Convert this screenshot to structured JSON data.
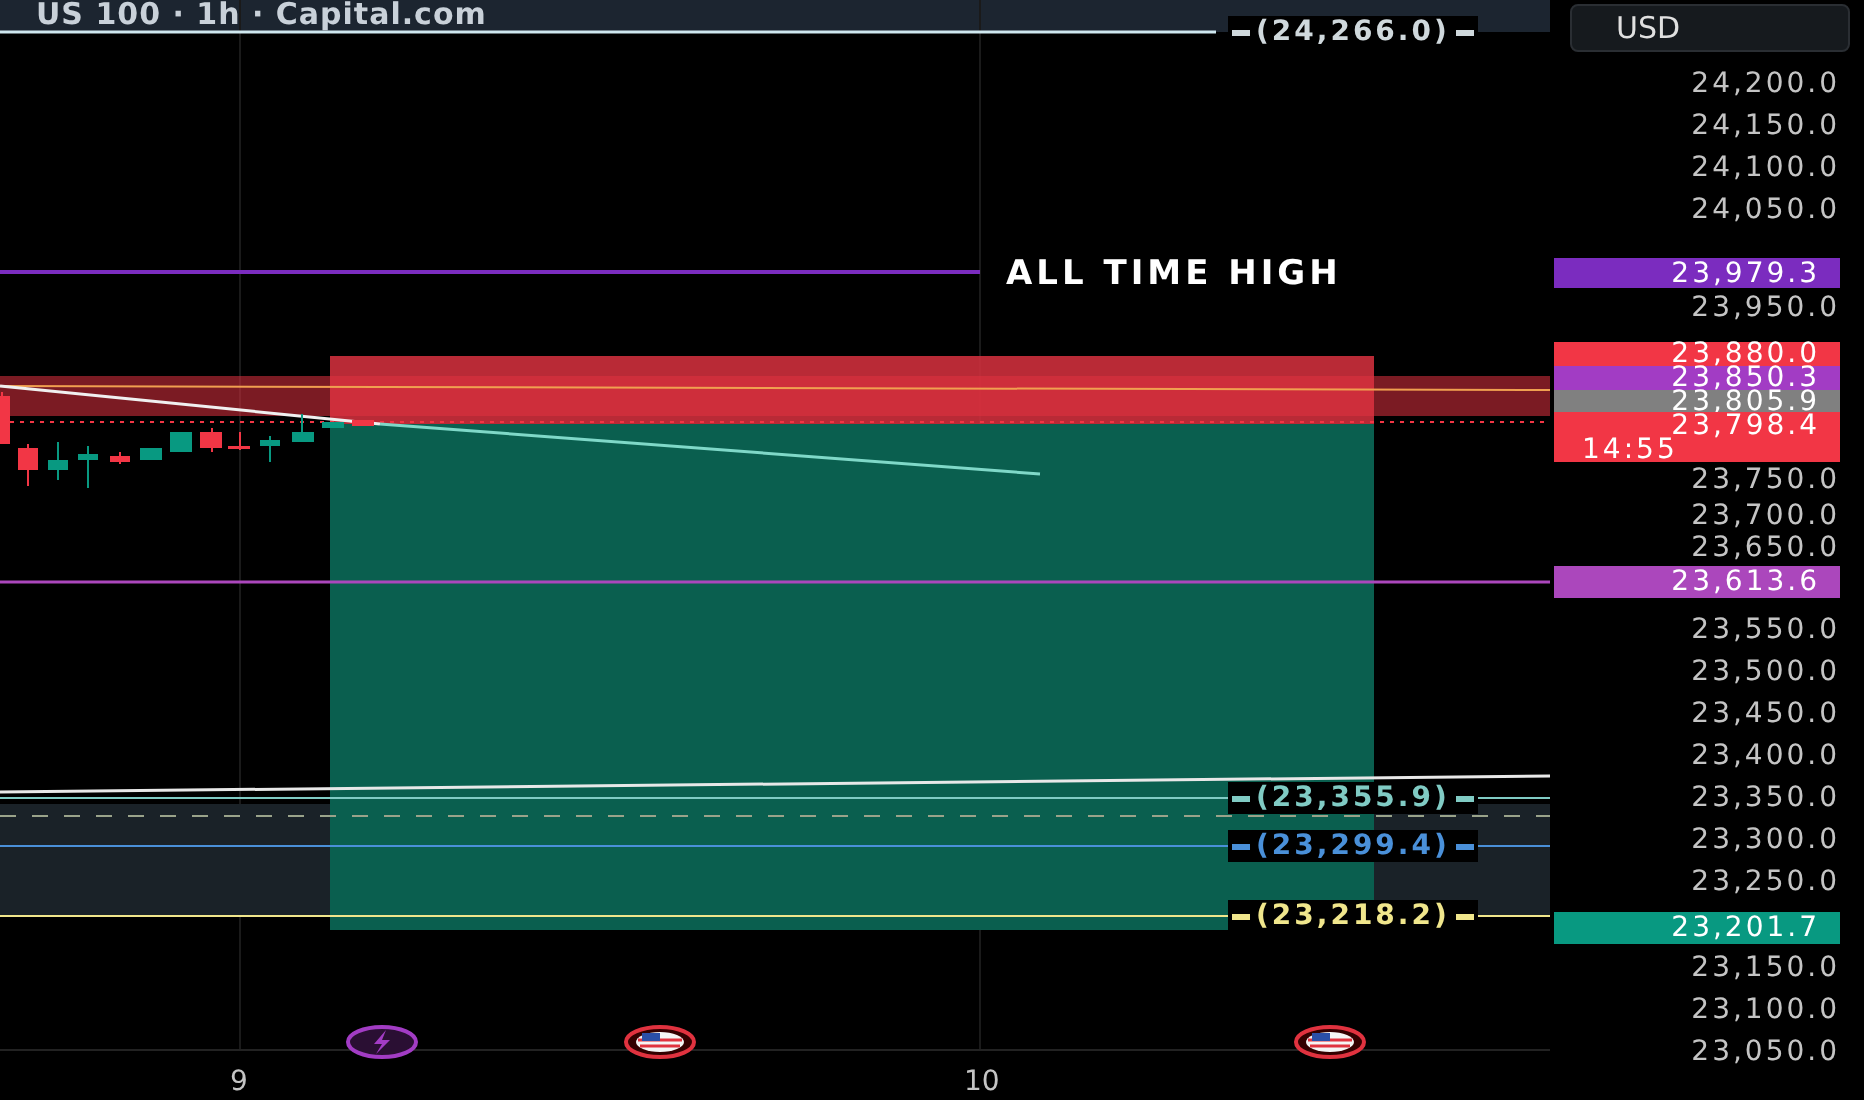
{
  "header": {
    "title": "US 100 · 1h · Capital.com"
  },
  "currency_button": "USD",
  "price_axis": {
    "ticks": [
      "24,200.0",
      "24,150.0",
      "24,100.0",
      "24,050.0",
      "23,950.0",
      "23,750.0",
      "23,700.0",
      "23,650.0",
      "23,550.0",
      "23,500.0",
      "23,450.0",
      "23,400.0",
      "23,350.0",
      "23,300.0",
      "23,250.0",
      "23,150.0",
      "23,100.0",
      "23,050.0"
    ]
  },
  "price_badges": [
    {
      "text": "23,979.3",
      "color": "#7b2cbf"
    },
    {
      "text": "23,880.0",
      "color": "#f23645"
    },
    {
      "text": "23,850.3",
      "color": "#a23cc4"
    },
    {
      "text": "23,805.9",
      "color": "#808080"
    },
    {
      "text": "23,798.4",
      "countdown": "14:55",
      "color": "#f23645"
    },
    {
      "text": "23,613.6",
      "color": "#ab47bc"
    },
    {
      "text": "23,201.7",
      "color": "#089981"
    }
  ],
  "line_labels": [
    {
      "text": "(24,266.0)",
      "color": "#cfd8dc"
    },
    {
      "text": "(23,355.9)",
      "color": "#80cbc4"
    },
    {
      "text": "(23,299.4)",
      "color": "#4a90d9"
    },
    {
      "text": "(23,218.2)",
      "color": "#f0e68c"
    }
  ],
  "annotation": "ALL TIME HIGH",
  "time_axis": [
    "9",
    "10"
  ],
  "events": [
    {
      "kind": "lightning"
    },
    {
      "kind": "flag"
    },
    {
      "kind": "flag"
    }
  ]
}
